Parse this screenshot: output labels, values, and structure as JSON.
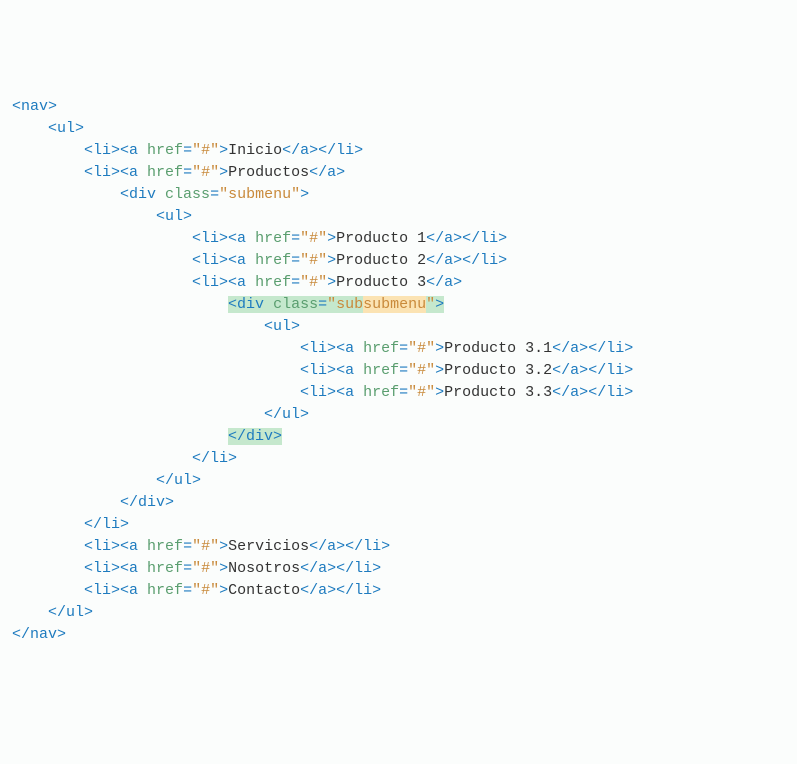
{
  "code": {
    "tags": {
      "nav_open": "<nav>",
      "nav_close": "</nav>",
      "ul_open": "<ul>",
      "ul_close": "</ul>",
      "li_open": "<li>",
      "li_close": "</li>",
      "a_open_pre": "<a ",
      "a_close": "</a>",
      "div_open_pre": "<div ",
      "div_close": "</div>",
      "close_bracket": ">"
    },
    "attrs": {
      "href_name": "href",
      "href_val": "\"#\"",
      "class_name": "class",
      "class_val_submenu": "\"submenu\"",
      "class_val_sub_prefix": "\"sub",
      "class_val_sub_suffix": "submenu",
      "class_val_sub_end": "\"",
      "eq": "="
    },
    "texts": {
      "inicio": "Inicio",
      "productos": "Productos",
      "producto1": "Producto 1",
      "producto2": "Producto 2",
      "producto3": "Producto 3",
      "producto31": "Producto 3.1",
      "producto32": "Producto 3.2",
      "producto33": "Producto 3.3",
      "servicios": "Servicios",
      "nosotros": "Nosotros",
      "contacto": "Contacto"
    }
  }
}
